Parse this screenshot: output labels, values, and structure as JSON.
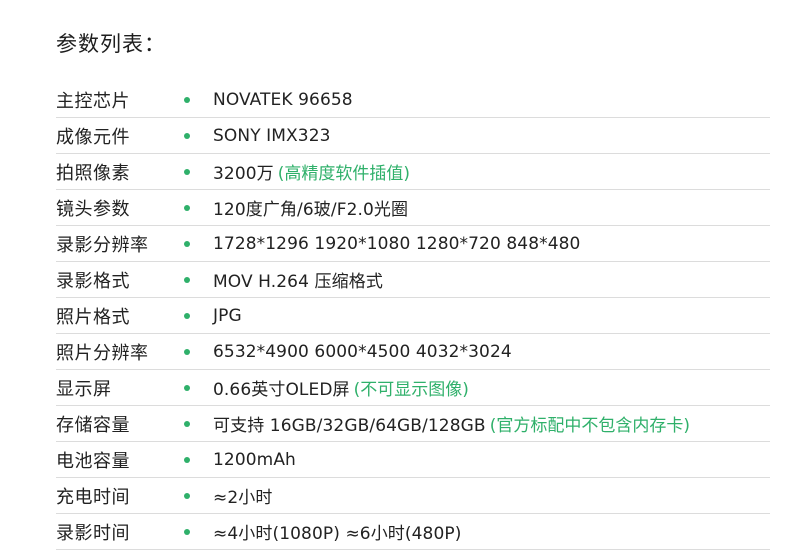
{
  "page_title": "参数列表：",
  "accent_color": "#2fb06a",
  "bullet_icon": "green-dot",
  "specs": [
    {
      "label": "主控芯片",
      "value": "NOVATEK  96658",
      "note": ""
    },
    {
      "label": "成像元件",
      "value": "SONY  IMX323",
      "note": ""
    },
    {
      "label": "拍照像素",
      "value": "3200万",
      "note": "(高精度软件插值)"
    },
    {
      "label": "镜头参数",
      "value": "120度广角/6玻/F2.0光圈",
      "note": ""
    },
    {
      "label": "录影分辨率",
      "value": "1728*1296 1920*1080 1280*720  848*480",
      "note": ""
    },
    {
      "label": "录影格式",
      "value": "MOV H.264 压缩格式",
      "note": ""
    },
    {
      "label": "照片格式",
      "value": "JPG",
      "note": ""
    },
    {
      "label": "照片分辨率",
      "value": "6532*4900 6000*4500 4032*3024",
      "note": ""
    },
    {
      "label": "显示屏",
      "value": "0.66英寸OLED屏",
      "note": "(不可显示图像)"
    },
    {
      "label": "存储容量",
      "value": "可支持 16GB/32GB/64GB/128GB",
      "note": "(官方标配中不包含内存卡)"
    },
    {
      "label": "电池容量",
      "value": "1200mAh",
      "note": ""
    },
    {
      "label": "充电时间",
      "value": "≈2小时",
      "note": ""
    },
    {
      "label": "录影时间",
      "value": "≈4小时(1080P) ≈6小时(480P)",
      "note": ""
    }
  ]
}
